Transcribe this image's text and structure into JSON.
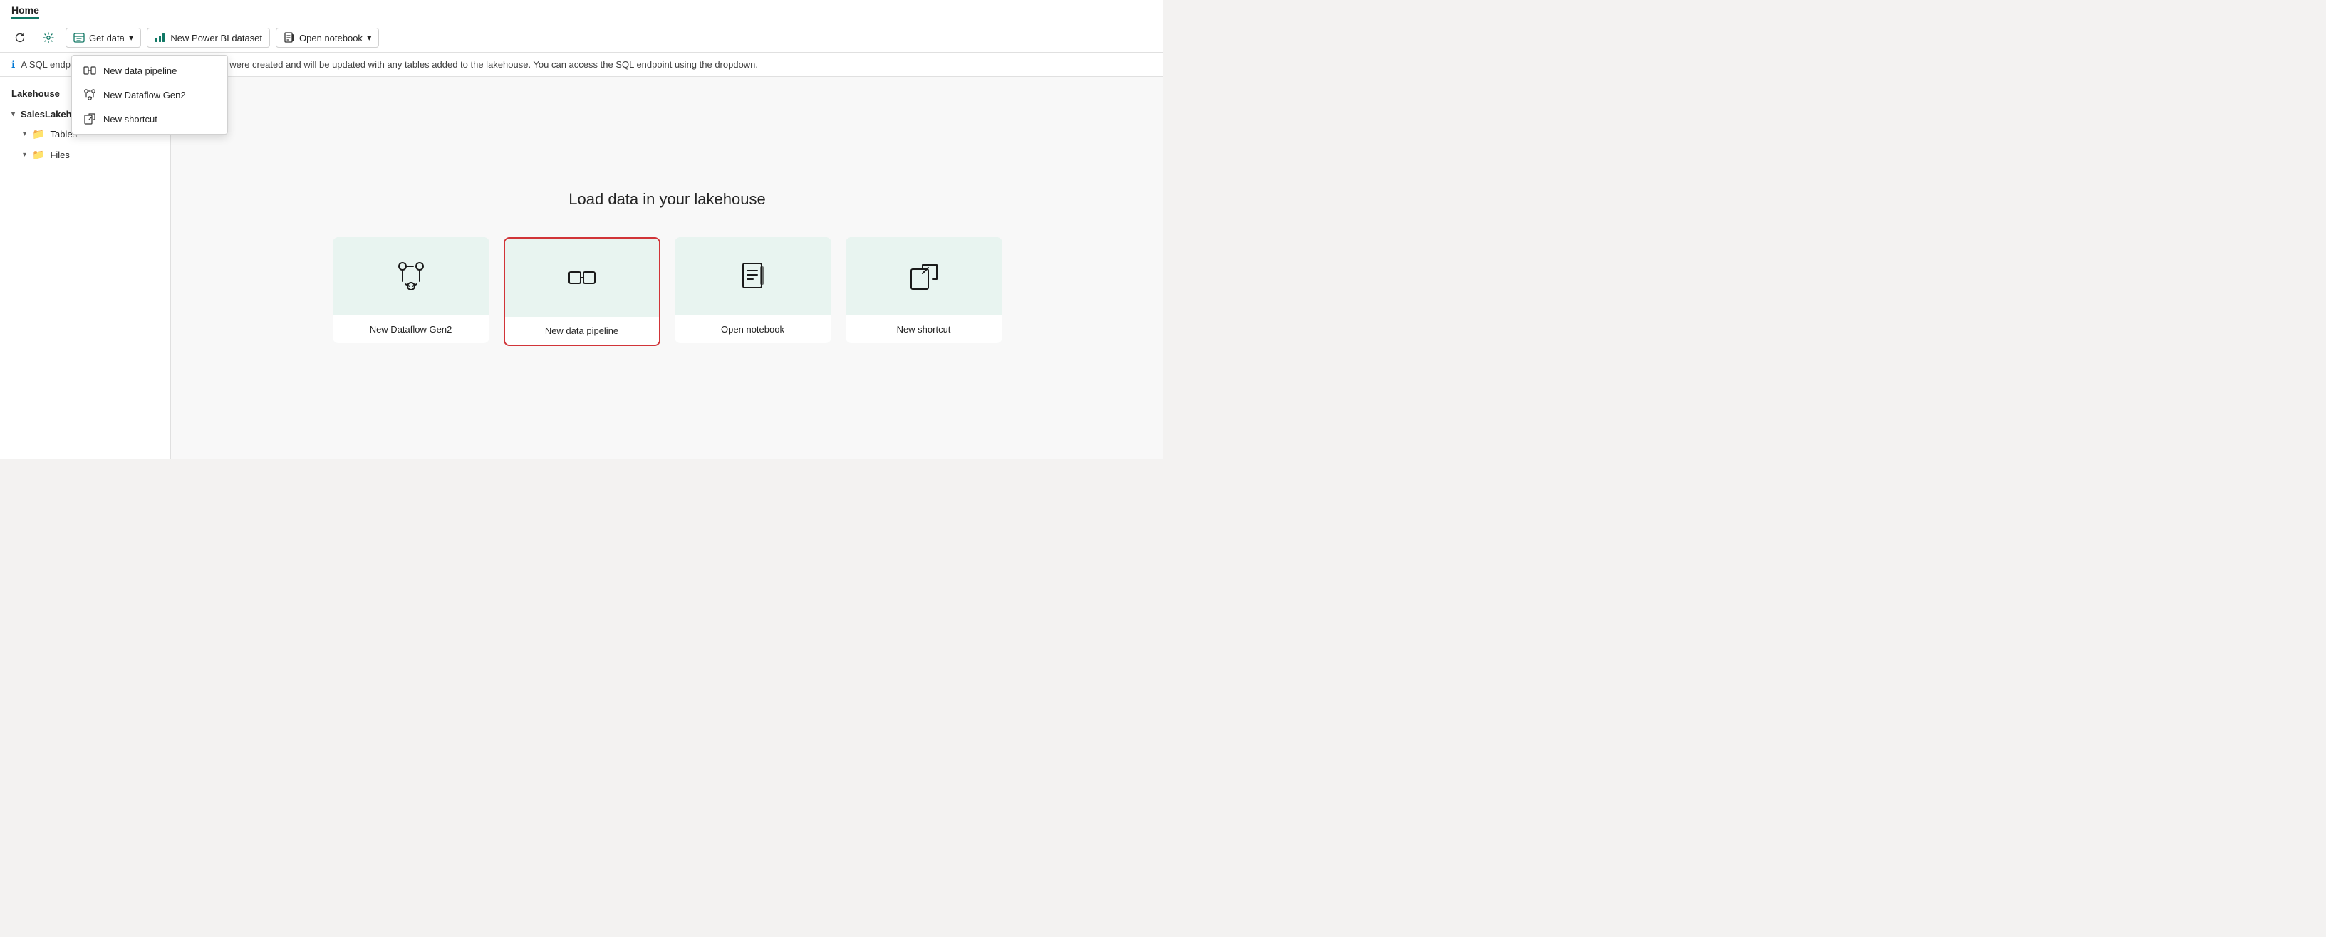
{
  "titlebar": {
    "title": "Home"
  },
  "toolbar": {
    "refresh_label": "",
    "settings_label": "",
    "get_data_label": "Get data",
    "new_power_bi_label": "New Power BI dataset",
    "open_notebook_label": "Open notebook"
  },
  "dropdown": {
    "items": [
      {
        "id": "new-data-pipeline",
        "label": "New data pipeline"
      },
      {
        "id": "new-dataflow-gen2",
        "label": "New Dataflow Gen2"
      },
      {
        "id": "new-shortcut",
        "label": "New shortcut"
      }
    ]
  },
  "infobar": {
    "text": "A SQL endpoint and a default dataset for reporting were created and will be updated with any tables added to the lakehouse. You can access the SQL endpoint using the dropdown."
  },
  "sidebar": {
    "title": "Lakehouse",
    "tree": {
      "root": "SalesLakehouse",
      "children": [
        "Tables",
        "Files"
      ]
    }
  },
  "content": {
    "title": "Load data in your lakehouse",
    "cards": [
      {
        "id": "new-dataflow-gen2",
        "label": "New Dataflow Gen2",
        "highlighted": false
      },
      {
        "id": "new-data-pipeline",
        "label": "New data pipeline",
        "highlighted": true
      },
      {
        "id": "open-notebook",
        "label": "Open notebook",
        "highlighted": false
      },
      {
        "id": "new-shortcut",
        "label": "New shortcut",
        "highlighted": false
      }
    ]
  }
}
